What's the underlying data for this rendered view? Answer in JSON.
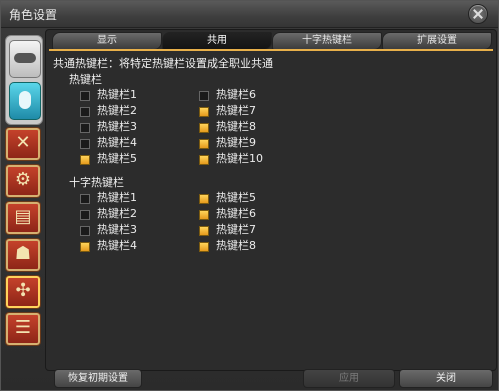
{
  "window": {
    "title": "角色设置"
  },
  "tabs": [
    {
      "label": "显示",
      "active": false
    },
    {
      "label": "共用",
      "active": true
    },
    {
      "label": "十字热键栏",
      "active": false
    },
    {
      "label": "扩展设置",
      "active": false
    }
  ],
  "description": "共通热键栏：将特定热键栏设置成全职业共通",
  "hotbar": {
    "heading": "热键栏",
    "items": [
      {
        "label": "热键栏1",
        "checked": false
      },
      {
        "label": "热键栏2",
        "checked": false
      },
      {
        "label": "热键栏3",
        "checked": false
      },
      {
        "label": "热键栏4",
        "checked": false
      },
      {
        "label": "热键栏5",
        "checked": true
      },
      {
        "label": "热键栏6",
        "checked": false
      },
      {
        "label": "热键栏7",
        "checked": true
      },
      {
        "label": "热键栏8",
        "checked": true
      },
      {
        "label": "热键栏9",
        "checked": true
      },
      {
        "label": "热键栏10",
        "checked": true
      }
    ]
  },
  "cross_hotbar": {
    "heading": "十字热键栏",
    "items": [
      {
        "label": "热键栏1",
        "checked": false
      },
      {
        "label": "热键栏2",
        "checked": false
      },
      {
        "label": "热键栏3",
        "checked": false
      },
      {
        "label": "热键栏4",
        "checked": true
      },
      {
        "label": "热键栏5",
        "checked": true
      },
      {
        "label": "热键栏6",
        "checked": true
      },
      {
        "label": "热键栏7",
        "checked": true
      },
      {
        "label": "热键栏8",
        "checked": true
      }
    ]
  },
  "footer": {
    "reset_label": "恢复初期设置",
    "apply_label": "应用",
    "close_label": "关闭"
  },
  "colors": {
    "accent": "#e8b04a",
    "checked": "#f5b93a"
  }
}
